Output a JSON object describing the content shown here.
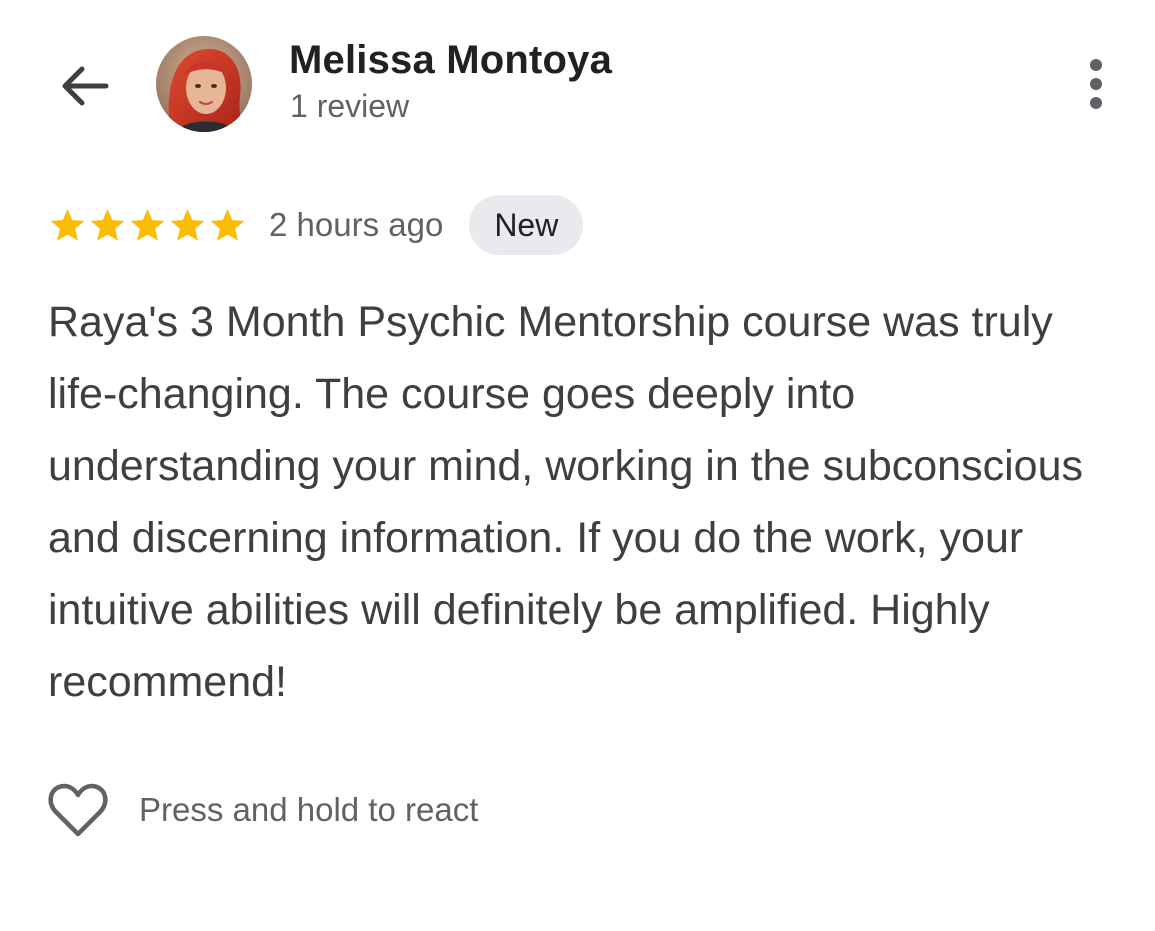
{
  "reviewer": {
    "name": "Melissa Montoya",
    "review_count": "1 review",
    "avatar_icon": "profile-photo"
  },
  "review": {
    "rating": 5,
    "rating_max": 5,
    "time": "2 hours ago",
    "badge": "New",
    "text": "Raya's 3 Month Psychic Mentorship course was truly life-changing. The course goes deeply into understanding your mind, working in the subconscious and discerning information. If you do the work, your intuitive abilities will definitely be amplified. Highly recommend!"
  },
  "reaction": {
    "label": "Press and hold to react",
    "icon": "heart-outline-icon"
  },
  "icons": {
    "back": "arrow-back-icon",
    "more": "more-vert-icon",
    "star": "star-icon"
  },
  "colors": {
    "star": "#fbbc04",
    "badge_bg": "#e8eaed",
    "text_primary": "#202124",
    "text_secondary": "#5f6368",
    "body_text": "#3c4043"
  }
}
